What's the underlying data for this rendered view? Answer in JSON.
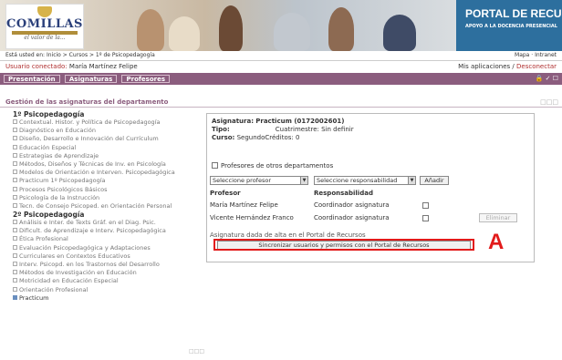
{
  "header": {
    "logo_name": "COMILLAS",
    "logo_motto": "el valor de la...",
    "portal_title": "PORTAL DE RECURSOS",
    "portal_subtitle": "APOYO A LA DOCENCIA PRESENCIAL"
  },
  "breadcrumb": {
    "left": "Está usted en: Inicio > Cursos > 1º de Psicopedagogía",
    "right": "Mapa · Intranet"
  },
  "userbar": {
    "label": "Usuario conectado:",
    "user": "María Martínez Felipe",
    "apps": "Mis aplicaciones /",
    "logout": "Desconectar"
  },
  "tabs": [
    "Presentación",
    "Asignaturas",
    "Profesores"
  ],
  "section_title": "Gestión de las asignaturas del departamento",
  "sidebar": {
    "group1": "1º Psicopedagogía",
    "items1": [
      "Contextual. Histor. y Política de Psicopedagogía",
      "Diagnóstico en Educación",
      "Diseño, Desarrollo e Innovación del Currículum",
      "Educación Especial",
      "Estrategias de Aprendizaje",
      "Métodos, Diseños y Técnicas de Inv. en Psicología",
      "Modelos de Orientación e Interven. Psicopedagógica",
      "Practicum 1º Psicopedagogía",
      "Procesos Psicológicos Básicos",
      "Psicología de la Instrucción",
      "Tecn. de Consejo Psicoped. en Orientación Personal"
    ],
    "group2": "2º Psicopedagogía",
    "items2": [
      "Análisis e Inter. de Texts Gráf. en el Diag. Psic.",
      "Dificult. de Aprendizaje e Interv. Psicopedagógica",
      "Ética Profesional",
      "Evaluación Psicopedagógica y Adaptaciones",
      "Curriculares en Contextos Educativos",
      "Interv. Psicopd. en los Trastornos del Desarrollo",
      "Métodos de Investigación en Educación",
      "Motricidad en Educación Especial",
      "Orientación Profesional"
    ],
    "active_item": "Practicum"
  },
  "panel": {
    "asignatura_label": "Asignatura:",
    "asignatura_value": "Practicum (0172002601)",
    "tipo_label": "Tipo:",
    "cuatrimestre": "Cuatrimestre: Sin definir",
    "curso_label": "Curso:",
    "curso_value": "SegundoCréditos: 0",
    "otros_label": "Profesores de otros departamentos",
    "select_profesor": "Seleccione profesor",
    "select_resp": "Seleccione responsabilidad",
    "add_button": "Añadir",
    "col_profesor": "Profesor",
    "col_resp": "Responsabilidad",
    "rows": [
      {
        "profesor": "María Martínez Felipe",
        "resp": "Coordinador asignatura"
      },
      {
        "profesor": "Vicente Hernández Franco",
        "resp": "Coordinador asignatura"
      }
    ],
    "delete_button": "Eliminar",
    "sync_note": "Asignatura dada de alta en el Portal de Recursos",
    "sync_button": "Sincronizar usuarios y permisos con el Portal de Recursos"
  },
  "annotation_label": "A",
  "colors": {
    "accent": "#8b5d7e",
    "portal": "#2d6f9e",
    "highlight": "#e21b1b"
  }
}
